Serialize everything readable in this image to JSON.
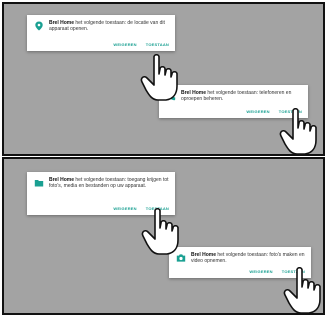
{
  "app_name": "Brel Home",
  "dialogs": [
    {
      "icon": "location-pin-icon",
      "text": " het volgende toestaan: de locatie van dit apparaat openen.",
      "deny": "WEIGEREN",
      "allow": "TOESTAAN"
    },
    {
      "icon": "phone-icon",
      "text": " het volgende toestaan: telefoneren en oproepen beheren.",
      "deny": "WEIGEREN",
      "allow": "TOESTAAN"
    },
    {
      "icon": "folder-icon",
      "text": " het volgende toestaan: toegang krijgen tot foto's, media en bestanden op uw apparaat.",
      "deny": "WEIGEREN",
      "allow": "TOESTAAN"
    },
    {
      "icon": "camera-icon",
      "text": " het volgende toestaan: foto's maken en video opnemen.",
      "deny": "WEIGEREN",
      "allow": "TOESTAAN"
    }
  ],
  "colors": {
    "accent": "#1aa092",
    "backdrop": "#a3a3a3"
  }
}
